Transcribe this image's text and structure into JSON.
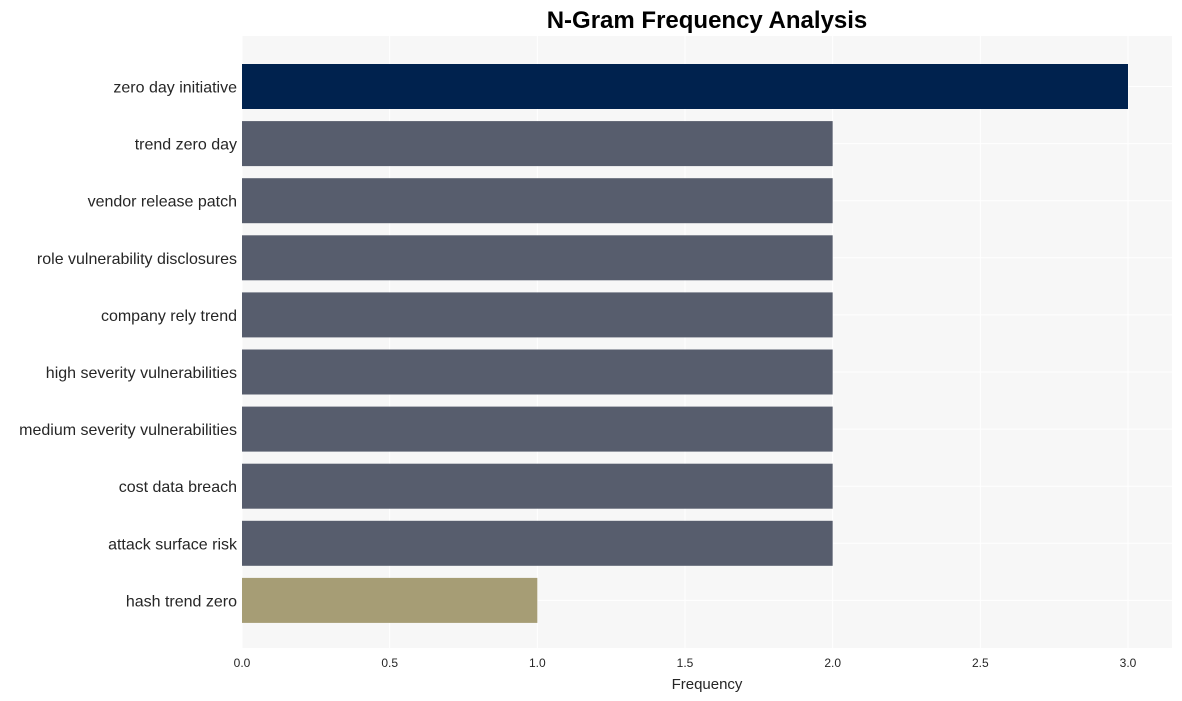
{
  "chart_data": {
    "type": "bar",
    "orientation": "horizontal",
    "title": "N-Gram Frequency Analysis",
    "xlabel": "Frequency",
    "ylabel": "",
    "categories": [
      "zero day initiative",
      "trend zero day",
      "vendor release patch",
      "role vulnerability disclosures",
      "company rely trend",
      "high severity vulnerabilities",
      "medium severity vulnerabilities",
      "cost data breach",
      "attack surface risk",
      "hash trend zero"
    ],
    "values": [
      3,
      2,
      2,
      2,
      2,
      2,
      2,
      2,
      2,
      1
    ],
    "bar_colors": [
      "#00224e",
      "#575d6d",
      "#575d6d",
      "#575d6d",
      "#575d6d",
      "#575d6d",
      "#575d6d",
      "#575d6d",
      "#575d6d",
      "#a69d75"
    ],
    "xlim": [
      0,
      3.15
    ],
    "xticks": [
      "0.0",
      "0.5",
      "1.0",
      "1.5",
      "2.0",
      "2.5",
      "3.0"
    ],
    "xtick_values": [
      0,
      0.5,
      1.0,
      1.5,
      2.0,
      2.5,
      3.0
    ],
    "grid": true,
    "legend": "none",
    "background": "#f7f7f7"
  }
}
